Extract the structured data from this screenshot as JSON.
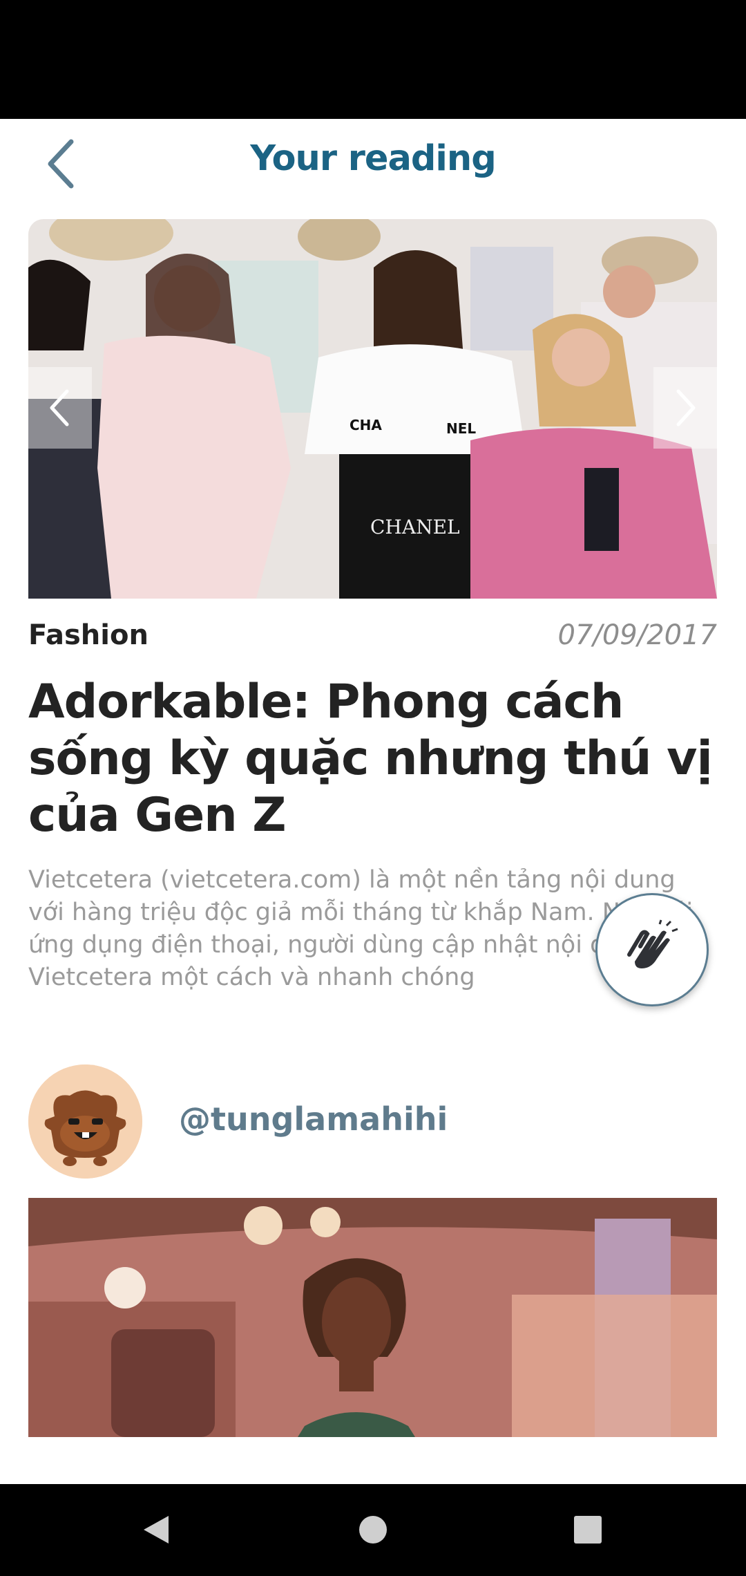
{
  "header": {
    "title": "Your reading"
  },
  "article": {
    "category": "Fashion",
    "date": "07/09/2017",
    "title": "Adorkable: Phong cách sống kỳ quặc nhưng thú vị của Gen Z",
    "excerpt": "Vietcetera (vietcetera.com) là một nền tảng nội dung với hàng triệu độc giả mỗi tháng từ khắp Nam. Nay với ứng dụng điện thoại, người dùng cập nhật nội dung của Vietcetera một cách và nhanh chóng"
  },
  "author": {
    "username": "@tunglamahihi"
  },
  "hero_image": {
    "printed_text": [
      "CHA",
      "NEL",
      "CHANEL"
    ]
  },
  "icons": {
    "back": "chevron-left-icon",
    "prev": "chevron-left-icon",
    "next": "chevron-right-icon",
    "clap": "clap-hands-icon",
    "nav_back": "triangle-back-icon",
    "nav_home": "circle-home-icon",
    "nav_recents": "square-recents-icon"
  },
  "colors": {
    "title_blue": "#1b6384",
    "username_gray_blue": "#5f7b8c",
    "text_dark": "#232323",
    "excerpt_gray": "#9a9a9a"
  }
}
